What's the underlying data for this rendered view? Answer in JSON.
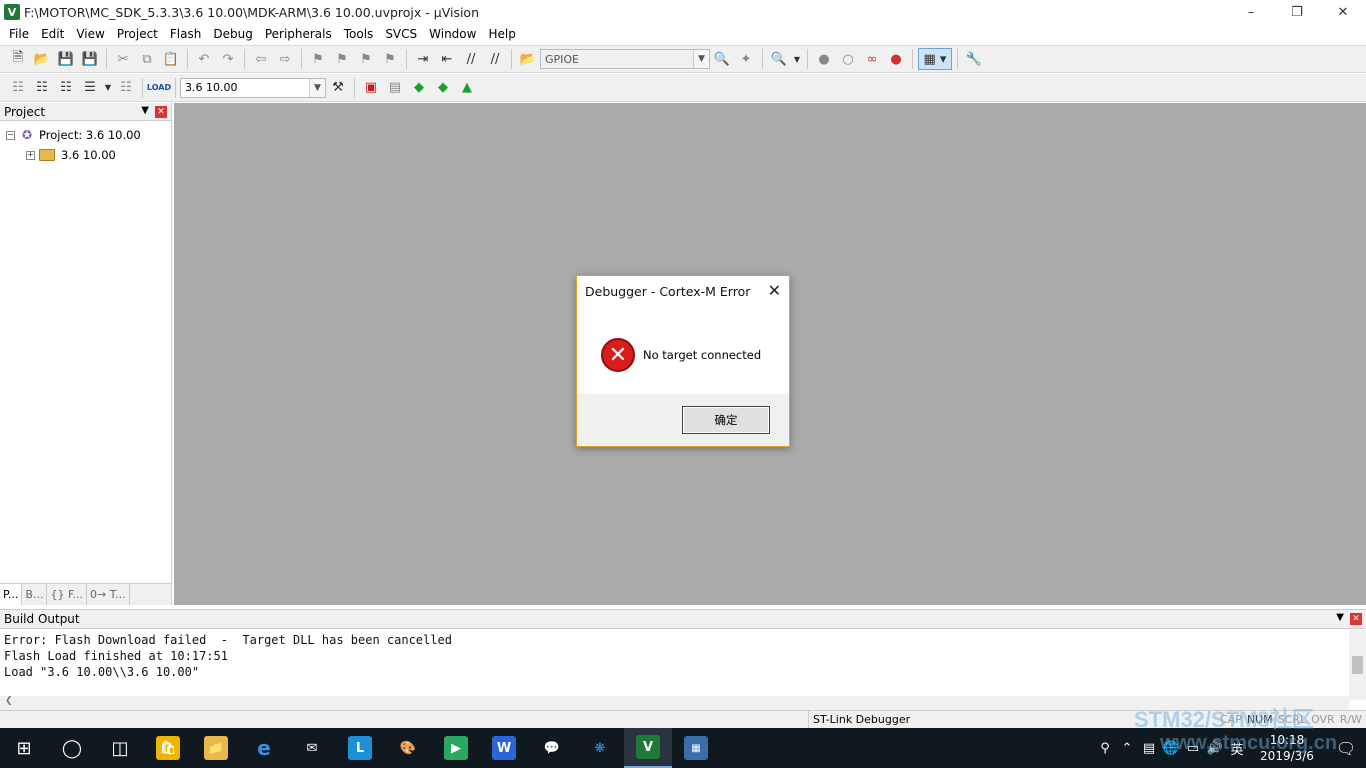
{
  "window": {
    "title": "F:\\MOTOR\\MC_SDK_5.3.3\\3.6 10.00\\MDK-ARM\\3.6 10.00.uvprojx - µVision",
    "app_icon_letter": "V"
  },
  "menu": [
    "File",
    "Edit",
    "View",
    "Project",
    "Flash",
    "Debug",
    "Peripherals",
    "Tools",
    "SVCS",
    "Window",
    "Help"
  ],
  "toolbar1": {
    "find_combo_value": "GPIOE"
  },
  "toolbar2": {
    "target_combo_value": "3.6 10.00"
  },
  "project_pane": {
    "title": "Project",
    "root_label": "Project: 3.6 10.00",
    "child_label": "3.6 10.00",
    "tabs": [
      "P...",
      "B...",
      "{} F...",
      "0→ T..."
    ]
  },
  "dialog": {
    "title": "Debugger - Cortex-M Error",
    "message": "No target connected",
    "ok_label": "确定",
    "accent": "#e0a12a"
  },
  "build_output": {
    "title": "Build Output",
    "lines": [
      "Error: Flash Download failed  -  Target DLL has been cancelled",
      "Flash Load finished at 10:17:51",
      "Load \"3.6 10.00\\\\3.6 10.00\""
    ]
  },
  "statusbar": {
    "debugger": "ST-Link Debugger",
    "keys": [
      "CAP",
      "NUM",
      "SCRL",
      "OVR",
      "R/W"
    ]
  },
  "taskbar": {
    "ime": "英",
    "time": "10:18",
    "date": "2019/3/6"
  },
  "watermark": {
    "line1": "STM32/STM8社区",
    "line2": "www.stmcu.org.cn"
  }
}
